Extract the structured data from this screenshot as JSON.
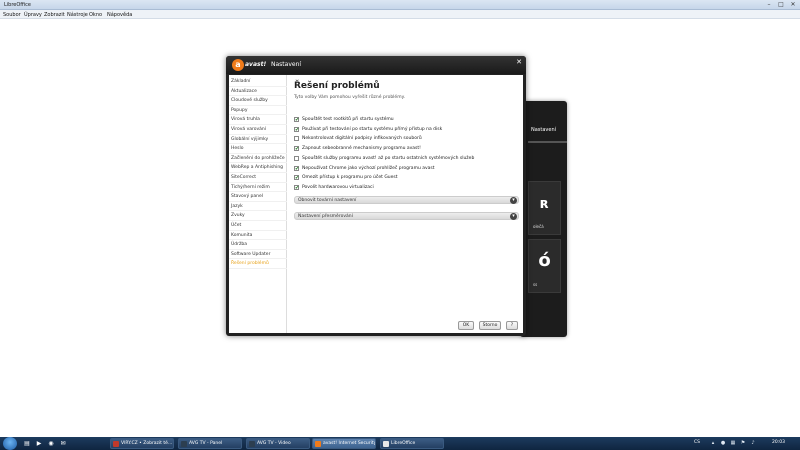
{
  "libreoffice": {
    "title": "LibreOffice",
    "menu": [
      "Soubor",
      "Úpravy",
      "Zobrazit",
      "Nástroje",
      "Okno",
      "Nápověda"
    ]
  },
  "back_window": {
    "tab": "Nastavení",
    "tile1_text": "olečá",
    "tile2_text": "ss"
  },
  "dialog": {
    "brand": "avast!",
    "title": "Nastavení",
    "sidebar": [
      "Základní",
      "Aktualizace",
      "Cloudové služby",
      "Popupy",
      "Virová truhla",
      "Virová varování",
      "Globální výjimky",
      "Heslo",
      "Začlenění do prohlížeče",
      "WebRep a Antiphishing",
      "SiteCorrect",
      "Tichý/herní režim",
      "Stavový panel",
      "Jazyk",
      "Zvuky",
      "Účet",
      "Komunita",
      "Údržba",
      "Software Updater",
      "Řešení problémů"
    ],
    "active_index": 19,
    "content_title": "Řešení problémů",
    "content_desc": "Tyto volby Vám pomohou vyřešit různé problémy.",
    "options": [
      {
        "label": "Spouštět test rootkitů při startu systému",
        "checked": true
      },
      {
        "label": "Používat při testování po startu systému přímý přístup na disk",
        "checked": true
      },
      {
        "label": "Nekontrolovat digitální podpisy infikovaných souborů",
        "checked": false
      },
      {
        "label": "Zapnout sebeobranné mechanismy programu avast!",
        "checked": true
      },
      {
        "label": "Spouštět služby programu avast! až po startu ostatních systémových služeb",
        "checked": false
      },
      {
        "label": "Nepoužívat Chrome jako výchozí prohlížeč programu avast",
        "checked": true
      },
      {
        "label": "Omezit přístup k programu pro účet Guest",
        "checked": true
      },
      {
        "label": "Povolit hardwarovou virtualizaci",
        "checked": true
      }
    ],
    "sections": [
      "Obnovit tovární nastavení",
      "Nastavení přesměrování"
    ],
    "buttons": {
      "ok": "OK",
      "storno": "Storno",
      "help": "?"
    }
  },
  "taskbar": {
    "tasks": [
      {
        "label": "VIRY.CZ • Zobrazit té...",
        "color": "#c0392b"
      },
      {
        "label": "AVG TV - Panel",
        "color": "#2c3e50"
      },
      {
        "label": "AVG TV - Video",
        "color": "#2c3e50"
      },
      {
        "label": "avast! Internet Security",
        "color": "#f07b1a"
      },
      {
        "label": "LibreOffice",
        "color": "#e8e8e8"
      }
    ],
    "lang": "CS",
    "time": "20:03"
  }
}
